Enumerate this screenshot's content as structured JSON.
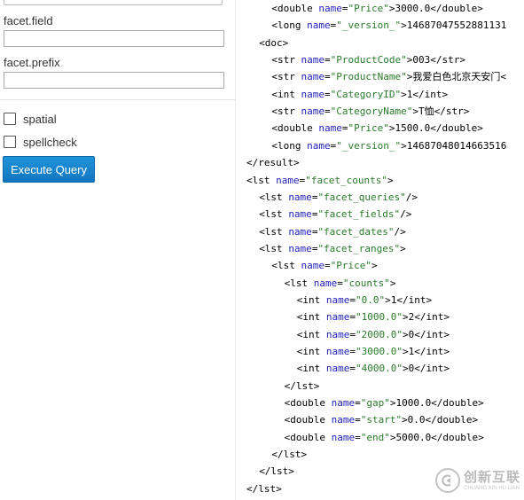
{
  "form": {
    "facet_field_label": "facet.field",
    "facet_field_value": "",
    "facet_prefix_label": "facet.prefix",
    "facet_prefix_value": "",
    "spatial_label": "spatial",
    "spellcheck_label": "spellcheck",
    "execute_label": "Execute Query"
  },
  "xml_lines": [
    {
      "indent": 2,
      "text": "<double name=\"Price\">3000.0</double>"
    },
    {
      "indent": 2,
      "text": "<long name=\"_version_\">14687047552881131"
    },
    {
      "indent": 1,
      "text": "<doc>"
    },
    {
      "indent": 2,
      "text": "<str name=\"ProductCode\">003</str>"
    },
    {
      "indent": 2,
      "text": "<str name=\"ProductName\">我爱白色北京天安门<"
    },
    {
      "indent": 2,
      "text": "<int name=\"CategoryID\">1</int>"
    },
    {
      "indent": 2,
      "text": "<str name=\"CategoryName\">T恤</str>"
    },
    {
      "indent": 2,
      "text": "<double name=\"Price\">1500.0</double>"
    },
    {
      "indent": 2,
      "text": "<long name=\"_version_\">14687048014663516"
    },
    {
      "indent": 0,
      "text": "</result>"
    },
    {
      "indent": 0,
      "text": "<lst name=\"facet_counts\">"
    },
    {
      "indent": 1,
      "text": "<lst name=\"facet_queries\"/>"
    },
    {
      "indent": 1,
      "text": "<lst name=\"facet_fields\"/>"
    },
    {
      "indent": 1,
      "text": "<lst name=\"facet_dates\"/>"
    },
    {
      "indent": 1,
      "text": "<lst name=\"facet_ranges\">"
    },
    {
      "indent": 2,
      "text": "<lst name=\"Price\">"
    },
    {
      "indent": 3,
      "text": "<lst name=\"counts\">"
    },
    {
      "indent": 4,
      "text": "<int name=\"0.0\">1</int>"
    },
    {
      "indent": 4,
      "text": "<int name=\"1000.0\">2</int>"
    },
    {
      "indent": 4,
      "text": "<int name=\"2000.0\">0</int>"
    },
    {
      "indent": 4,
      "text": "<int name=\"3000.0\">1</int>"
    },
    {
      "indent": 4,
      "text": "<int name=\"4000.0\">0</int>"
    },
    {
      "indent": 3,
      "text": "</lst>"
    },
    {
      "indent": 3,
      "text": "<double name=\"gap\">1000.0</double>"
    },
    {
      "indent": 3,
      "text": "<double name=\"start\">0.0</double>"
    },
    {
      "indent": 3,
      "text": "<double name=\"end\">5000.0</double>"
    },
    {
      "indent": 2,
      "text": "</lst>"
    },
    {
      "indent": 1,
      "text": "</lst>"
    },
    {
      "indent": 0,
      "text": "</lst>"
    }
  ],
  "watermark": {
    "name_cn": "创新互联",
    "name_en": "CHUANG XIN HU LIAN"
  },
  "colors": {
    "button": "#1a86cf",
    "xml_attr": "#2222bb",
    "xml_value": "#2a7a2a"
  }
}
